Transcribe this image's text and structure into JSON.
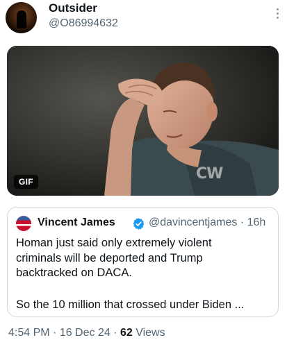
{
  "post": {
    "display_name": "Outsider",
    "handle": "@O86994632",
    "time": "4:54 PM",
    "sep1": " · ",
    "date": "16 Dec 24",
    "sep2": " · ",
    "views_count": "62",
    "views_label": " Views"
  },
  "media": {
    "badge": "GIF",
    "watermark": "CW"
  },
  "quoted": {
    "name": "Vincent James",
    "handle_time": "@davincentjames · 16h",
    "text": "Homan just said only extremely violent\ncriminals will be deported and Trump\nbacktracked on DACA.",
    "text2": "So the 10 million that crossed under Biden ..."
  },
  "colors": {
    "verified": "#1d9bf0",
    "secondary_text": "#536471"
  }
}
